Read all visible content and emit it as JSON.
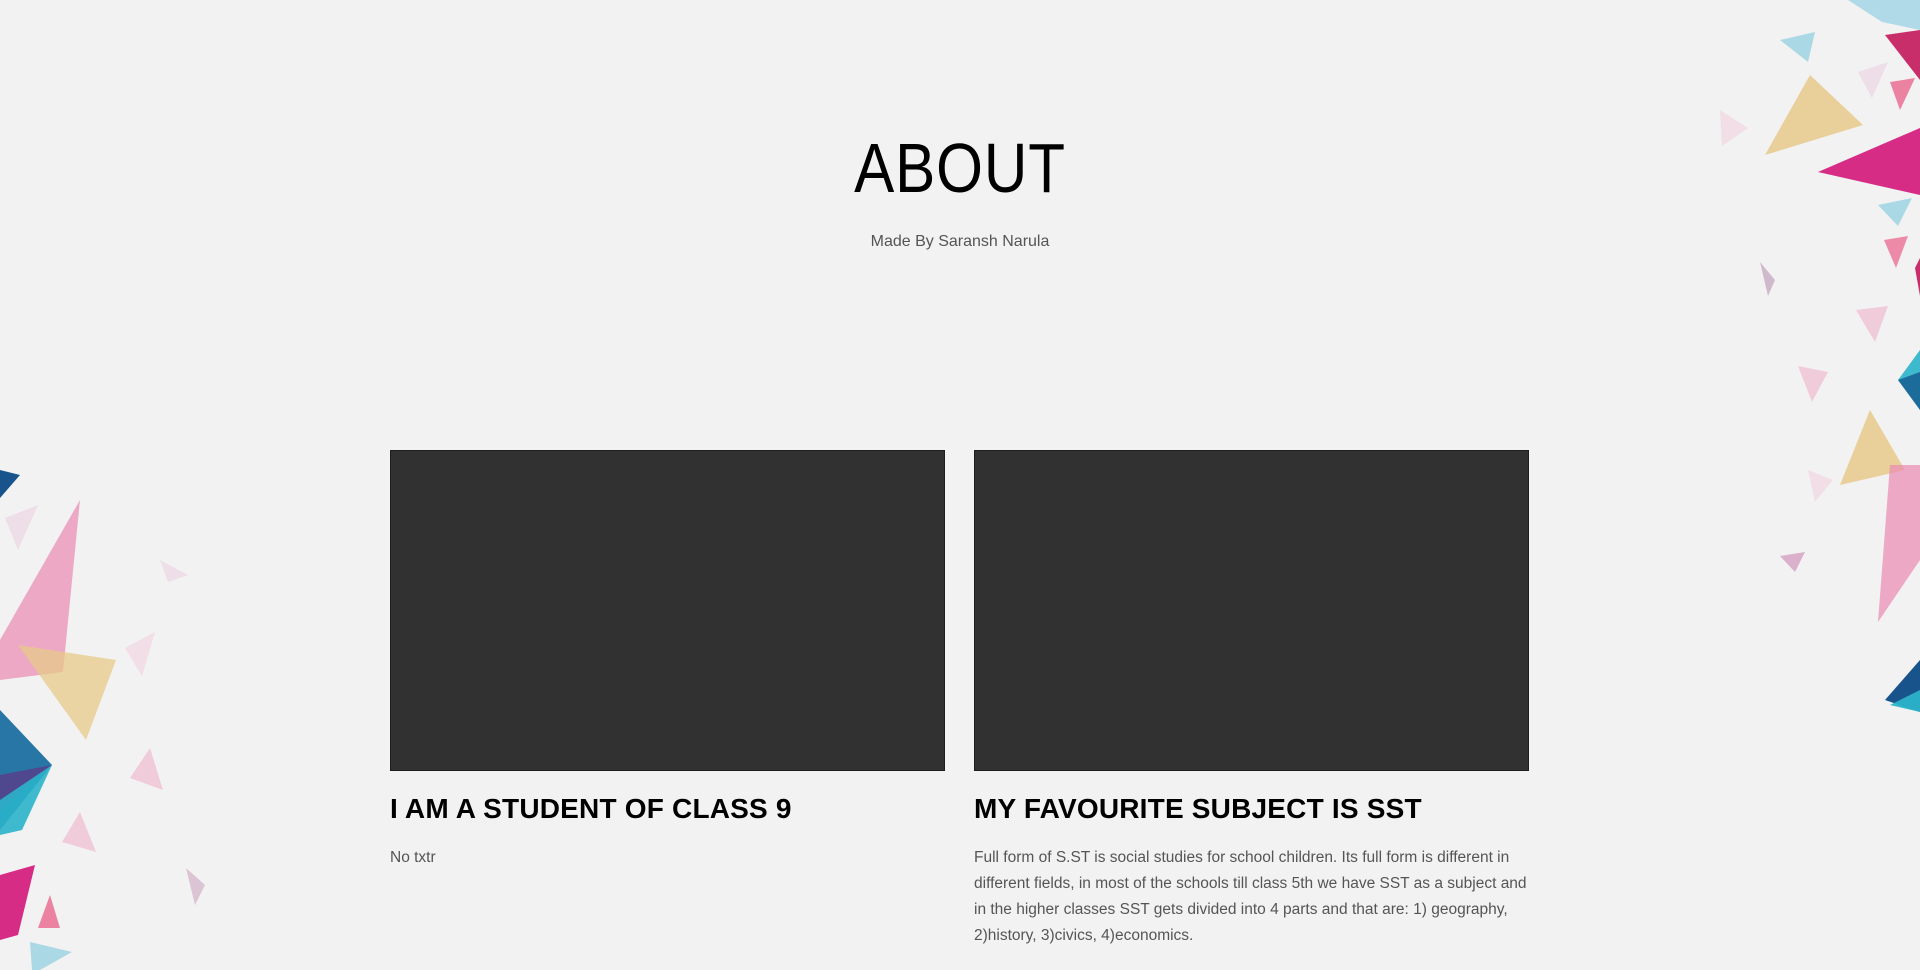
{
  "header": {
    "title": "ABOUT",
    "subtitle": "Made By Saransh Narula"
  },
  "cards": [
    {
      "title": "I AM A STUDENT OF CLASS 9",
      "text": "No txtr"
    },
    {
      "title": "MY FAVOURITE SUBJECT IS SST",
      "text": "Full form of S.ST is social studies for school children. Its full form is different in different fields, in most of the schools till class 5th we have SST as a subject and in the higher classes SST gets divided into 4 parts and that are: 1) geography, 2)history, 3)civics, 4)economics."
    }
  ],
  "colors": {
    "background": "#f2f2f2",
    "image_placeholder": "#313131",
    "text_muted": "#555555",
    "deco_magenta": "#d4217f",
    "deco_pink": "#e98fb4",
    "deco_gold": "#e8c98a",
    "deco_teal": "#2ab3c9",
    "deco_blue": "#1b6fa1",
    "deco_navy": "#0d4a86",
    "deco_purple": "#5a3d8a",
    "deco_lightblue": "#9fd3e3"
  }
}
